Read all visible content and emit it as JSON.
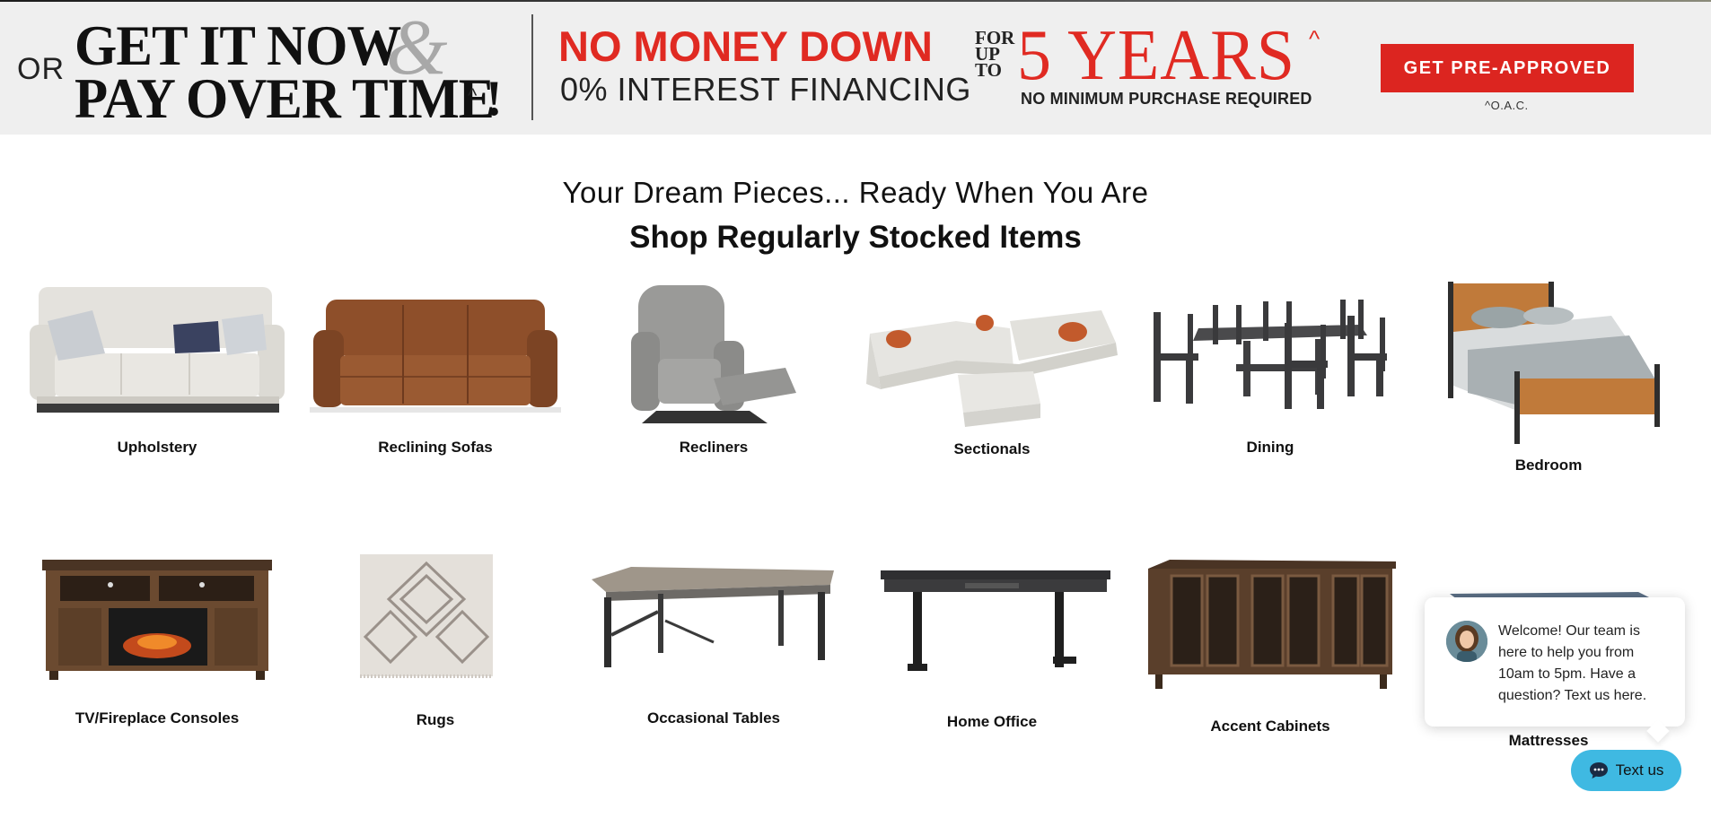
{
  "banner": {
    "or": "OR",
    "line1": "GET IT NOW",
    "ampersand": "&",
    "line2": "PAY OVER TIME",
    "caret": "^",
    "exclaim": "!",
    "no_money_down": "NO MONEY DOWN",
    "interest": "0% INTEREST FINANCING",
    "for": "FOR",
    "up": "UP",
    "to": "TO",
    "years": "5 YEARS",
    "years_caret": "^",
    "no_minimum": "NO MINIMUM PURCHASE REQUIRED",
    "cta_label": "GET PRE-APPROVED",
    "oac": "^O.A.C.",
    "accent_color": "#dc2520"
  },
  "section": {
    "subtitle": "Your Dream Pieces... Ready When You Are",
    "title": "Shop Regularly Stocked Items"
  },
  "categories": [
    {
      "label": "Upholstery",
      "icon": "sofa-image"
    },
    {
      "label": "Reclining Sofas",
      "icon": "reclining-sofa-image"
    },
    {
      "label": "Recliners",
      "icon": "recliner-image"
    },
    {
      "label": "Sectionals",
      "icon": "sectional-image"
    },
    {
      "label": "Dining",
      "icon": "dining-set-image"
    },
    {
      "label": "Bedroom",
      "icon": "bed-image"
    },
    {
      "label": "TV/Fireplace Consoles",
      "icon": "fireplace-console-image"
    },
    {
      "label": "Rugs",
      "icon": "rug-image"
    },
    {
      "label": "Occasional Tables",
      "icon": "coffee-table-image"
    },
    {
      "label": "Home Office",
      "icon": "desk-image"
    },
    {
      "label": "Accent Cabinets",
      "icon": "cabinet-image"
    },
    {
      "label": "Mattresses",
      "icon": "mattress-image"
    }
  ],
  "chat": {
    "welcome": "Welcome! Our team is here to help you from 10am to 5pm. Have a question? Text us here.",
    "button_label": "Text us",
    "button_color": "#3fb9e2"
  }
}
